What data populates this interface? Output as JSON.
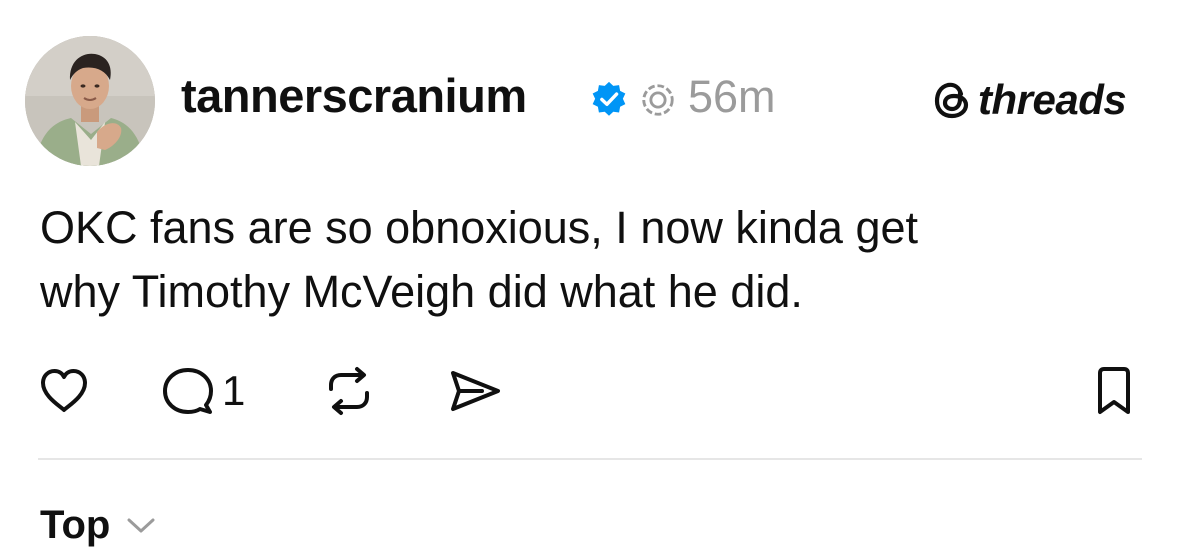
{
  "post": {
    "username": "tannerscranium",
    "verified": true,
    "timestamp": "56m",
    "brand": "threads",
    "text_lines": [
      "OKC fans are so obnoxious, I now kinda get",
      "why Timothy McVeigh did what he did."
    ],
    "reply_count": "1"
  },
  "icons": {
    "verified": "verified-badge-icon",
    "status": "ring-icon",
    "brand_mark": "threads-logo-icon",
    "like": "heart-icon",
    "reply": "comment-icon",
    "repost": "repost-icon",
    "share": "send-icon",
    "bookmark": "bookmark-icon",
    "sort": "chevron-down-icon"
  },
  "sort": {
    "label": "Top"
  },
  "colors": {
    "verified": "#0095f6",
    "muted": "#9b9b9b",
    "text": "#101010",
    "divider": "#e6e6e6"
  }
}
